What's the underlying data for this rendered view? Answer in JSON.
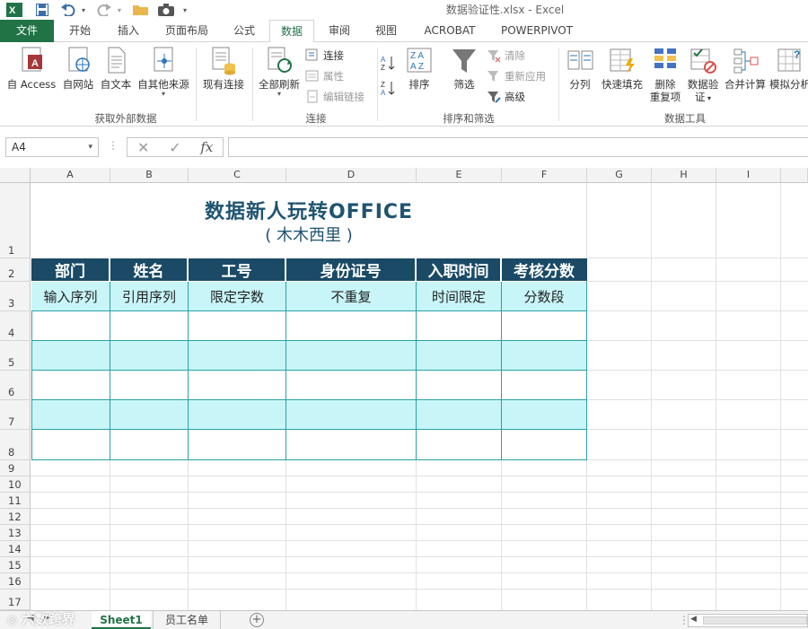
{
  "window": {
    "doc_title": "数据验证性.xlsx - Excel"
  },
  "tabs": [
    {
      "label": "文件"
    },
    {
      "label": "开始"
    },
    {
      "label": "插入"
    },
    {
      "label": "页面布局"
    },
    {
      "label": "公式"
    },
    {
      "label": "数据"
    },
    {
      "label": "审阅"
    },
    {
      "label": "视图"
    },
    {
      "label": "ACROBAT"
    },
    {
      "label": "POWERPIVOT"
    }
  ],
  "active_tab": "数据",
  "ribbon": {
    "get_external": {
      "group_label": "获取外部数据",
      "buttons": [
        "自 Access",
        "自网站",
        "自文本",
        "自其他来源",
        "现有连接"
      ]
    },
    "connections": {
      "group_label": "连接",
      "refresh_all": "全部刷新",
      "connections": "连接",
      "properties": "属性",
      "edit_links": "编辑链接"
    },
    "sort_filter": {
      "group_label": "排序和筛选",
      "sort": "排序",
      "filter": "筛选",
      "clear": "清除",
      "reapply": "重新应用",
      "advanced": "高级"
    },
    "data_tools": {
      "group_label": "数据工具",
      "text_to_columns": "分列",
      "flash_fill": "快速填充",
      "remove_dup_1": "删除",
      "remove_dup_2": "重复项",
      "validation_1": "数据验",
      "validation_2": "证",
      "consolidate": "合并计算",
      "what_if": "模拟分析"
    }
  },
  "formula_bar": {
    "name_box": "A4",
    "fx": "fx",
    "value": ""
  },
  "columns": [
    "A",
    "B",
    "C",
    "D",
    "E",
    "F",
    "G",
    "H",
    "I"
  ],
  "rows": [
    "1",
    "2",
    "3",
    "4",
    "5",
    "6",
    "7",
    "8",
    "9",
    "10",
    "11",
    "12",
    "13",
    "14",
    "15",
    "16",
    "17"
  ],
  "sheet": {
    "title": "数据新人玩转OFFICE",
    "subtitle": "( 木木西里 )",
    "headers": [
      "部门",
      "姓名",
      "工号",
      "身份证号",
      "入职时间",
      "考核分数"
    ],
    "subheaders": [
      "输入序列",
      "引用序列",
      "限定字数",
      "不重复",
      "时间限定",
      "分数段"
    ]
  },
  "sheet_tabs": [
    "Sheet1",
    "员工名单"
  ],
  "watermark": "六数跨界",
  "colors": {
    "excel_green": "#217346",
    "header_fill": "#1a4a66",
    "band_fill": "#c8f6f8",
    "title_color": "#1f5470"
  }
}
